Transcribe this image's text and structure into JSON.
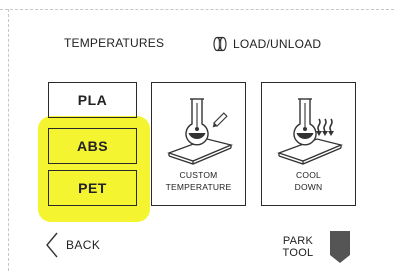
{
  "tabs": {
    "temperatures": "TEMPERATURES",
    "load_unload": "LOAD/UNLOAD"
  },
  "materials": [
    {
      "label": "PLA",
      "highlighted": false
    },
    {
      "label": "ABS",
      "highlighted": true
    },
    {
      "label": "PET",
      "highlighted": true
    }
  ],
  "actions": {
    "custom": {
      "line1": "CUSTOM",
      "line2": "TEMPERATURE",
      "icon": "flask-pencil-icon"
    },
    "cool": {
      "line1": "COOL",
      "line2": "DOWN",
      "icon": "flask-cooling-icon"
    }
  },
  "footer": {
    "back": "BACK",
    "park_line1": "PARK",
    "park_line2": "TOOL"
  },
  "colors": {
    "highlight": "#f4f431",
    "border": "#2a2a2a",
    "park_icon": "#555555"
  }
}
